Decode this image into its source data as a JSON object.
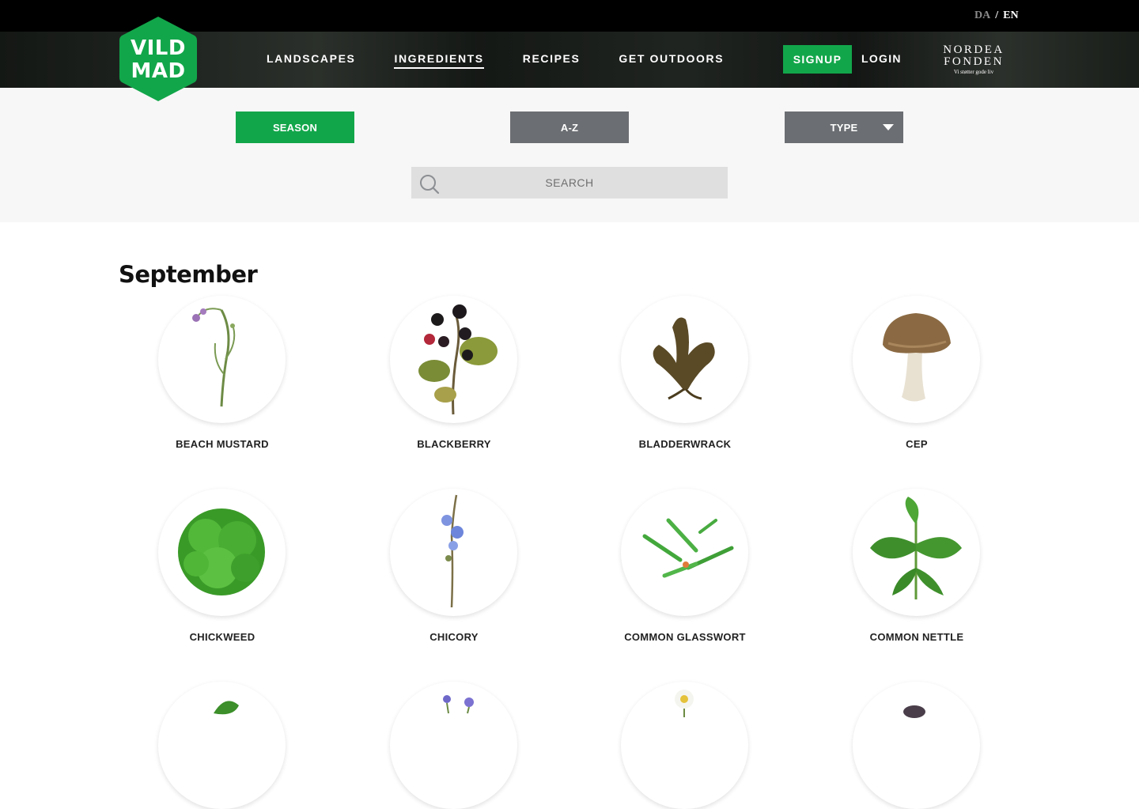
{
  "header": {
    "lang": {
      "da": "DA",
      "sep": "/",
      "en": "EN"
    },
    "logo": {
      "line1": "VILD",
      "line2": "MAD"
    },
    "nav": [
      "LANDSCAPES",
      "INGREDIENTS",
      "RECIPES",
      "GET OUTDOORS"
    ],
    "active_nav": "INGREDIENTS",
    "signup": "SIGNUP",
    "login": "LOGIN",
    "partner": {
      "line1": "NORDEA",
      "line2": "FONDEN",
      "tagline": "Vi støtter gode liv"
    }
  },
  "filters": {
    "season": "SEASON",
    "az": "A-Z",
    "type": "TYPE",
    "search_placeholder": "SEARCH"
  },
  "section": {
    "month": "September",
    "items": [
      {
        "name": "BEACH MUSTARD",
        "icon": "beach-mustard-image"
      },
      {
        "name": "BLACKBERRY",
        "icon": "blackberry-image"
      },
      {
        "name": "BLADDERWRACK",
        "icon": "bladderwrack-image"
      },
      {
        "name": "CEP",
        "icon": "cep-image"
      },
      {
        "name": "CHICKWEED",
        "icon": "chickweed-image"
      },
      {
        "name": "CHICORY",
        "icon": "chicory-image"
      },
      {
        "name": "COMMON GLASSWORT",
        "icon": "common-glasswort-image"
      },
      {
        "name": "COMMON NETTLE",
        "icon": "common-nettle-image"
      }
    ]
  },
  "colors": {
    "brand_green": "#12a64a",
    "filter_grey": "#6b6e72"
  }
}
